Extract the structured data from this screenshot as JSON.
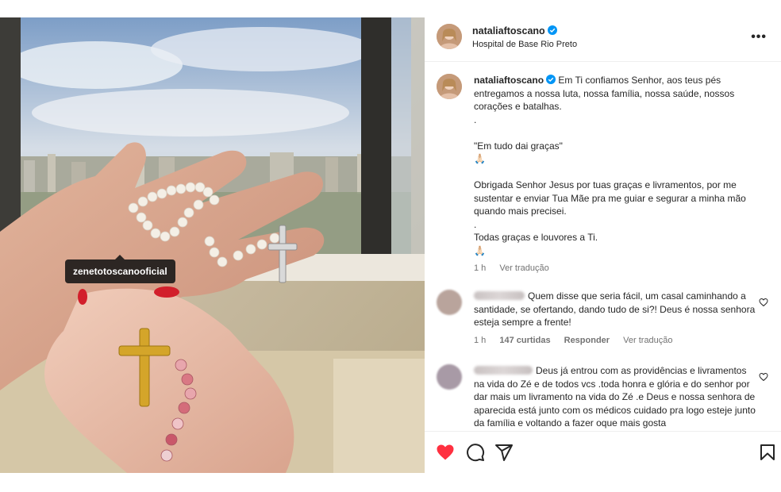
{
  "photo": {
    "tag_label": "zenetotoscanooficial"
  },
  "post": {
    "username": "nataliaftoscano",
    "location": "Hospital de Base Rio Preto",
    "more_label": "•••"
  },
  "caption": {
    "username": "nataliaftoscano",
    "text": "Em Ti confiamos Senhor, aos teus pés entregamos a nossa luta, nossa família, nossa saúde, nossos corações e batalhas.\n.\n\n\"Em tudo dai graças\"\n🙏🏻\n\nObrigada Senhor Jesus por tuas graças e livramentos, por me sustentar e enviar Tua Mãe pra me guiar e segurar a minha mão quando mais precisei.\n.\nTodas graças e louvores a Ti.\n🙏🏻",
    "time": "1 h",
    "translate": "Ver tradução"
  },
  "comments": [
    {
      "text": "Quem disse que seria fácil, um casal caminhando a santidade, se ofertando, dando tudo de si?! Deus é nossa senhora esteja sempre a frente!",
      "time": "1 h",
      "likes": "147 curtidas",
      "reply": "Responder",
      "translate": "Ver tradução"
    },
    {
      "text": "Deus já entrou com as providências e livramentos na vida do Zé e de todos vcs .toda honra e glória e do senhor por dar mais um livramento na vida do Zé .e Deus e nossa senhora de aparecida está junto com os médicos cuidado pra logo esteje junto da família e voltando a fazer oque mais gosta"
    }
  ],
  "colors": {
    "like_red": "#ff3040",
    "verified_blue": "#0095f6",
    "muted": "#737373"
  },
  "icons": [
    "heart-icon",
    "comment-icon",
    "share-icon",
    "bookmark-icon",
    "more-icon",
    "verified-icon"
  ]
}
